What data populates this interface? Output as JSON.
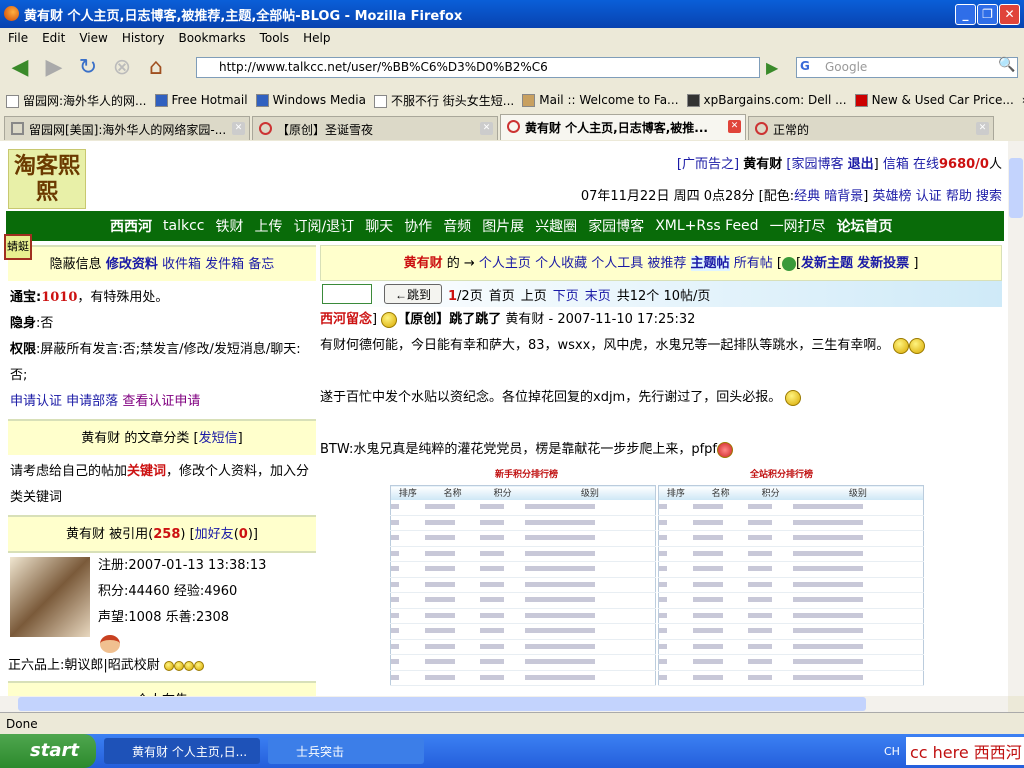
{
  "window": {
    "title": "黄有财 个人主页,日志博客,被推荐,主题,全部帖-BLOG - Mozilla Firefox"
  },
  "menu": [
    "File",
    "Edit",
    "View",
    "History",
    "Bookmarks",
    "Tools",
    "Help"
  ],
  "address": {
    "url": "http://www.talkcc.net/user/%BB%C6%D3%D0%B2%C6",
    "search_placeholder": "Google"
  },
  "bookmarks": [
    "留园网:海外华人的网...",
    "Free Hotmail",
    "Windows Media",
    "不服不行 街头女生短...",
    "Mail :: Welcome to Fa...",
    "xpBargains.com: Dell ...",
    "New & Used Car Price...",
    "»"
  ],
  "tabs": [
    {
      "label": "留园网[美国]:海外华人的网络家园-..."
    },
    {
      "label": "【原创】圣诞雪夜"
    },
    {
      "label": "黄有财 个人主页,日志博客,被推...",
      "active": true
    },
    {
      "label": "正常的"
    }
  ],
  "page": {
    "logo": "淘客熙熙",
    "top1": {
      "ad": "[广而告之]",
      "user": "黄有财",
      "blog": "[家园博客",
      "logout": "退出",
      "close": "]",
      "mail": "信箱",
      "online_label": "在线",
      "online": "9680/0",
      "unit": "人"
    },
    "top2": {
      "date": "07年11月22日 周四 0点28分",
      "color_open": "[配色:",
      "classic": "经典",
      "dark": "暗背景",
      "color_close": "]",
      "heroes": "英雄榜",
      "auth": "认证",
      "help": "帮助",
      "search": "搜索"
    },
    "nav": [
      "西西河",
      "talkcc",
      "铁财",
      "上传",
      "订阅/退订",
      "聊天",
      "协作",
      "音频",
      "图片展",
      "兴趣圈",
      "家园博客",
      "XML+Rss Feed",
      "一网打尽",
      "论坛首页"
    ],
    "sticker": "蜻蜓",
    "left": {
      "toolbar": [
        "隐蔽信息",
        "修改资料",
        "收件箱",
        "发件箱",
        "备忘"
      ],
      "tongbao_label": "通宝:",
      "tongbao": "1010",
      "tongbao_note": "，有特殊用处。",
      "hidden_label": "隐身",
      "hidden": ":否",
      "perm_label": "权限",
      "perm": ":屏蔽所有发言:否;禁发言/修改/发短消息/聊天:否;",
      "links": [
        "申请认证",
        "申请部落",
        "查看认证申请"
      ],
      "category_title": "黄有财 的文章分类 [",
      "sms": "发短信",
      "category_close": "]",
      "hint_pre": "请考虑给自己的帖加",
      "hint_kw": "关键词",
      "hint_post": "，修改个人资料，加入分类关键词",
      "cited_pre": "黄有财 被引用(",
      "cited": "258",
      "cited_mid": ") [",
      "addfriend": "加好友",
      "friend_open": "(",
      "friends": "0",
      "friend_close": ")]",
      "reg": "注册:2007-01-13 13:38:13",
      "score": "积分:44460 经验:4960",
      "fame": "声望:1008 乐善:2308",
      "rank": "正六品上:朝议郎|昭武校尉",
      "notice": "个人布告"
    },
    "right": {
      "user": "黄有财",
      "of": "的 →",
      "links": [
        "个人主页",
        "个人收藏",
        "个人工具",
        "被推荐",
        "主题帖",
        "所有帖"
      ],
      "new_topic": "发新主题",
      "new_vote": "发新投票",
      "jump": "←跳到",
      "page_cur": "1",
      "page_rest": "/2页",
      "first": "首页",
      "prev": "上页",
      "next": "下页",
      "last": "末页",
      "total": "共12个 10帖/页",
      "post": {
        "forum": "西河留念",
        "bracket": "]",
        "title": "【原创】跳了跳了",
        "author": "黄有财",
        "date": "- 2007-11-10 17:25:32",
        "p1": "有财何德何能，今日能有幸和萨大，83，wsxx，风中虎，水鬼兄等一起排队等跳水，三生有幸啊。",
        "p2": "遂于百忙中发个水贴以资纪念。各位掉花回复的xdjm，先行谢过了，回头必报。",
        "p3": "BTW:水鬼兄真是纯粹的灌花党党员，楞是靠献花一步步爬上来，pfpf"
      },
      "image": {
        "left_title": "新手积分排行榜",
        "right_title": "全站积分排行榜",
        "cols": [
          "排序",
          "名称",
          "积分",
          "级别"
        ]
      }
    }
  },
  "status": "Done",
  "taskbar": {
    "start": "start",
    "tasks": [
      "黄有财 个人主页,日...",
      "士兵突击"
    ],
    "lang": "CH",
    "tray_brand": "cc here 西西河"
  }
}
